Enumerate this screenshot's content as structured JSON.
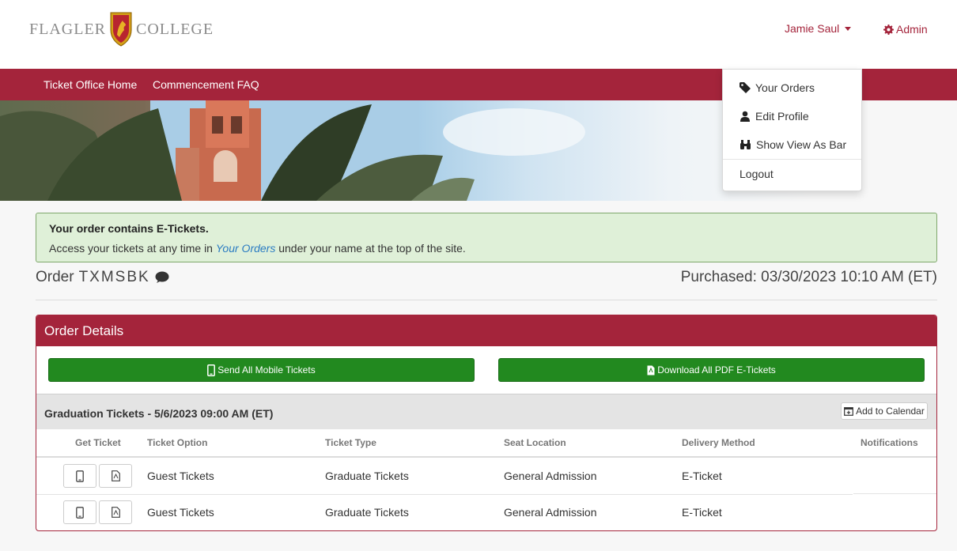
{
  "header": {
    "logo_left": "FLAGLER",
    "logo_right": "COLLEGE",
    "user_name": "Jamie Saul",
    "admin_label": "Admin"
  },
  "nav": {
    "items": [
      {
        "label": "Ticket Office Home"
      },
      {
        "label": "Commencement FAQ"
      }
    ]
  },
  "user_dropdown": {
    "items": [
      {
        "label": "Your Orders",
        "icon": "tag-icon"
      },
      {
        "label": "Edit Profile",
        "icon": "user-icon"
      },
      {
        "label": "Show View As Bar",
        "icon": "binoculars-icon"
      }
    ],
    "logout": "Logout"
  },
  "alert": {
    "title": "Your order contains E-Tickets.",
    "text_before": "Access your tickets at any time in ",
    "link_text": "Your Orders",
    "text_after": " under your name at the top of the site."
  },
  "order": {
    "label": "Order",
    "code": "TXMSBK",
    "purchased": "Purchased: 03/30/2023 10:10 AM (ET)"
  },
  "panel": {
    "title": "Order Details",
    "send_mobile_label": "Send All Mobile Tickets",
    "download_pdf_label": "Download All PDF E-Tickets"
  },
  "event": {
    "title": "Graduation Tickets - 5/6/2023 09:00 AM (ET)",
    "add_calendar_label": "Add to Calendar"
  },
  "table": {
    "columns": [
      "Get Ticket",
      "Ticket Option",
      "Ticket Type",
      "Seat Location",
      "Delivery Method",
      "Notifications"
    ],
    "rows": [
      {
        "option": "Guest Tickets",
        "type": "Graduate Tickets",
        "seat": "General Admission",
        "delivery": "E-Ticket"
      },
      {
        "option": "Guest Tickets",
        "type": "Graduate Tickets",
        "seat": "General Admission",
        "delivery": "E-Ticket"
      }
    ]
  },
  "colors": {
    "brand": "#a4243b",
    "success_button": "#22891f",
    "alert_bg": "#dff0d8",
    "link": "#2a7bc2"
  }
}
